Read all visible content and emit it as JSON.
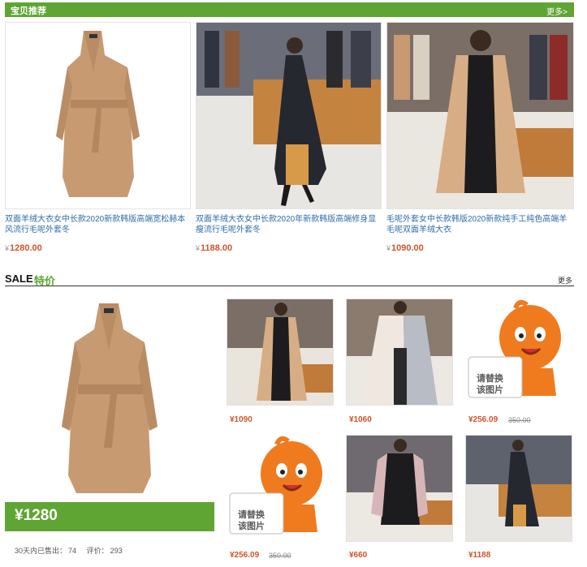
{
  "header": {
    "title": "宝贝推荐",
    "more": "更多>"
  },
  "products": [
    {
      "title": "双面羊绒大衣女中长款2020新款韩版高端宽松赫本风流行毛呢外套冬",
      "currency": "¥",
      "price": "1280.00"
    },
    {
      "title": "双面羊绒大衣女中长款2020年新款韩版高端修身显瘦流行毛呢外套冬",
      "currency": "¥",
      "price": "1188.00"
    },
    {
      "title": "毛呢外套女中长款韩版2020新款纯手工纯色高端羊毛呢双面羊绒大衣",
      "currency": "¥",
      "price": "1090.00"
    }
  ],
  "sale": {
    "title_en": "SALE",
    "title_cn": "特价",
    "more": "更多",
    "feature_price": "¥1280",
    "stats": {
      "sold_label": "30天内已售出：",
      "sold": "74",
      "review_label": "评价：",
      "reviews": "293"
    },
    "grid": [
      {
        "price": "¥1090",
        "original": ""
      },
      {
        "price": "¥1060",
        "original": ""
      },
      {
        "price": "¥256.09",
        "original": "350.00",
        "placeholder": [
          "请替换",
          "该图片"
        ]
      },
      {
        "price": "¥256.09",
        "original": "350.00",
        "placeholder": [
          "请替换",
          "该图片"
        ]
      },
      {
        "price": "¥660",
        "original": ""
      },
      {
        "price": "¥1188",
        "original": ""
      }
    ]
  },
  "colors": {
    "brand_green": "#5fa533",
    "price_red": "#d2542a",
    "coat_camel": "#c79a72",
    "mascot_orange": "#f07a1e"
  }
}
